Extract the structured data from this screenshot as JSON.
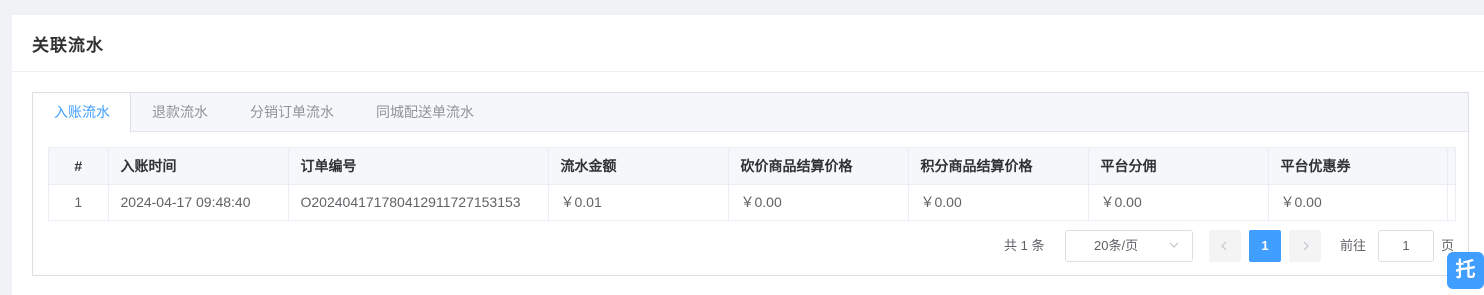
{
  "card": {
    "title": "关联流水"
  },
  "tabs": [
    {
      "label": "入账流水",
      "active": true
    },
    {
      "label": "退款流水",
      "active": false
    },
    {
      "label": "分销订单流水",
      "active": false
    },
    {
      "label": "同城配送单流水",
      "active": false
    }
  ],
  "table": {
    "headers": [
      "#",
      "入账时间",
      "订单编号",
      "流水金额",
      "砍价商品结算价格",
      "积分商品结算价格",
      "平台分佣",
      "平台优惠券"
    ],
    "rows": [
      [
        "1",
        "2024-04-17 09:48:40",
        "O20240417178041291172715315​3",
        "￥0.01",
        "￥0.00",
        "￥0.00",
        "￥0.00",
        "￥0.00"
      ]
    ]
  },
  "pagination": {
    "total": "共 1 条",
    "page_size": "20条/页",
    "prev_icon": "chevron-left-icon",
    "current_page": "1",
    "next_icon": "chevron-right-icon",
    "goto_label": "前往",
    "goto_value": "1",
    "goto_suffix": "页"
  },
  "float_button": {
    "label": "托"
  },
  "colors": {
    "accent": "#409eff",
    "header_bg": "#f5f7fa"
  }
}
